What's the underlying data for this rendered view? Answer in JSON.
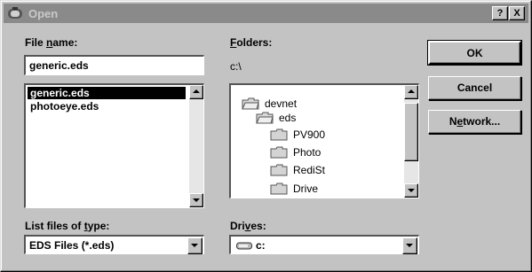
{
  "window": {
    "title": "Open",
    "help_label": "?",
    "close_label": "X"
  },
  "file_name": {
    "label_pre": "File ",
    "label_ul": "n",
    "label_post": "ame:",
    "value": "generic.eds",
    "files": [
      "generic.eds",
      "photoeye.eds"
    ],
    "selected_index": 0
  },
  "folders": {
    "label_ul": "F",
    "label_post": "olders:",
    "current_path": "c:\\",
    "items": [
      "devnet",
      "eds",
      "PV900",
      "Photo",
      "RediSt",
      "Drive"
    ]
  },
  "file_type": {
    "label_pre": "List files of ",
    "label_ul": "t",
    "label_post": "ype:",
    "value": "EDS Files (*.eds)"
  },
  "drives": {
    "label_pre": "Dri",
    "label_ul": "v",
    "label_post": "es:",
    "value": "c:"
  },
  "buttons": {
    "ok": "OK",
    "cancel": "Cancel",
    "network_pre": "N",
    "network_ul": "e",
    "network_post": "twork..."
  },
  "colors": {
    "face": "#c3c3c3",
    "titlebar": "#8a8a8a",
    "selection": "#000000"
  }
}
